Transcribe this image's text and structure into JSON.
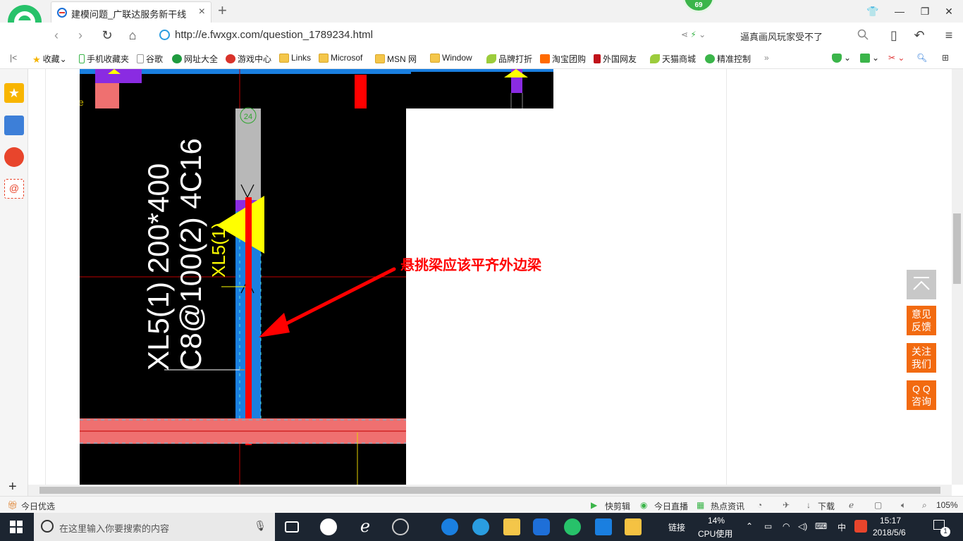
{
  "browser": {
    "tab_title": "建模问题_广联达服务新干线",
    "badge_count": "69",
    "url": "http://e.fwxgx.com/question_1789234.html",
    "news_ticker": "逼真画风玩家受不了"
  },
  "bookmarks": [
    {
      "label": "收藏",
      "icon": "star-icon"
    },
    {
      "label": "手机收藏夹",
      "icon": "phone-icon"
    },
    {
      "label": "谷歌",
      "icon": "page-icon"
    },
    {
      "label": "网址大全",
      "icon": "globe-icon"
    },
    {
      "label": "游戏中心",
      "icon": "game-icon"
    },
    {
      "label": "Links",
      "icon": "folder-icon"
    },
    {
      "label": "Microsof",
      "icon": "folder-icon"
    },
    {
      "label": "MSN 网",
      "icon": "folder-icon"
    },
    {
      "label": "Window",
      "icon": "folder-icon"
    },
    {
      "label": "品牌打折",
      "icon": "leaf-icon"
    },
    {
      "label": "淘宝团购",
      "icon": "taobao-icon"
    },
    {
      "label": "外国网友",
      "icon": "flag-icon"
    },
    {
      "label": "天猫商城",
      "icon": "leaf-icon"
    },
    {
      "label": "精准控制",
      "icon": "wechat-icon"
    }
  ],
  "cad": {
    "grid_number": "24",
    "beam_label_1": "XL5(1) 200*400",
    "beam_label_2": "C8@100(2) 4C16",
    "beam_label_small": "XL5(1)",
    "annotation": "悬挑梁应该平齐外边梁",
    "stray_char": "e"
  },
  "float_buttons": [
    {
      "label": "意见反馈",
      "line1": "意见",
      "line2": "反馈"
    },
    {
      "label": "关注我们",
      "line1": "关注",
      "line2": "我们"
    },
    {
      "label": "QQ咨询",
      "line1": "Q Q",
      "line2": "咨询"
    }
  ],
  "statusbar": {
    "left": "今日优选",
    "quick_edit": "快剪辑",
    "live": "今日直播",
    "hot_news": "热点资讯",
    "download": "下载",
    "zoom": "105%"
  },
  "taskbar": {
    "search_placeholder": "在这里输入你要搜索的内容",
    "link_label": "链接",
    "cpu_percent": "14%",
    "cpu_label": "CPU使用",
    "ime": "中",
    "time": "15:17",
    "date": "2018/5/6",
    "notification_count": "1"
  },
  "colors": {
    "brand_green": "#3bb54a",
    "float_orange": "#f26a10",
    "cad_background": "#000000",
    "beam_blue": "#1a7fe0",
    "beam_pink": "#ef7070",
    "annotation_red": "#ff0000"
  }
}
